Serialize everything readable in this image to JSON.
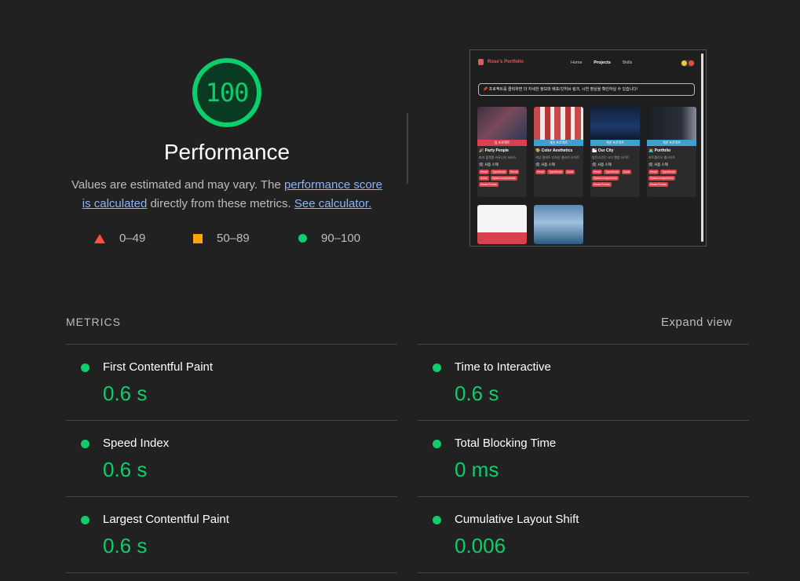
{
  "score": {
    "value": "100",
    "value_fraction": 1.0,
    "title": "Performance",
    "desc_part1": "Values are estimated and may vary. The ",
    "link_score": "performance score is calculated",
    "desc_part2": " directly from these metrics. ",
    "link_calc": "See calculator.",
    "color_pass": "#0cce6b"
  },
  "legend": [
    {
      "range": "0–49",
      "icon": "fail-triangle-icon",
      "color": "#ff4e42"
    },
    {
      "range": "50–89",
      "icon": "average-square-icon",
      "color": "#ffa400"
    },
    {
      "range": "90–100",
      "icon": "pass-circle-icon",
      "color": "#0cce6b"
    }
  ],
  "thumbnail": {
    "logo": "Rose's Portfolio",
    "nav": [
      "Home",
      "Projects",
      "Skills"
    ],
    "active_nav": "Projects",
    "banner": "📌 프로젝트를 클릭하면 더 자세한 정보와 배포/깃허브 링크, 시연 영상을 확인하실 수 있습니다!",
    "cards": [
      {
        "tag": "팀 프로젝트",
        "title": "🎉 Party People",
        "desc": "파티 플랫폼 커뮤니티 서비스",
        "stack": "🛠 사용 스택",
        "chips": [
          "React",
          "TypeScript",
          "Recoil",
          "Axios",
          "Styled-components",
          "React-Router"
        ]
      },
      {
        "tag": "개인 프로젝트",
        "title": "🎨 Color Aesthetics",
        "desc": "색상 팔레트 디자인 갤러리 사이트",
        "stack": "🛠 사용 스택",
        "chips": [
          "React",
          "TypeScript",
          "Axios"
        ]
      },
      {
        "tag": "개인 프로젝트",
        "title": "🏙 Our City",
        "desc": "방탄소년단 시티 앨범 사이트",
        "stack": "🛠 사용 스택",
        "chips": [
          "React",
          "TypeScript",
          "Axios",
          "Styled-components",
          "React-Router"
        ]
      },
      {
        "tag": "개인 프로젝트",
        "title": "👩‍💻 Portfolio",
        "desc": "포트폴리오 웹사이트",
        "stack": "🛠 사용 스택",
        "chips": [
          "React",
          "TypeScript",
          "Styled-components",
          "React-Router"
        ]
      }
    ]
  },
  "metrics": {
    "header": "METRICS",
    "expand": "Expand view",
    "left": [
      {
        "label": "First Contentful Paint",
        "value": "0.6 s"
      },
      {
        "label": "Speed Index",
        "value": "0.6 s"
      },
      {
        "label": "Largest Contentful Paint",
        "value": "0.6 s"
      }
    ],
    "right": [
      {
        "label": "Time to Interactive",
        "value": "0.6 s"
      },
      {
        "label": "Total Blocking Time",
        "value": "0 ms"
      },
      {
        "label": "Cumulative Layout Shift",
        "value": "0.006"
      }
    ]
  }
}
